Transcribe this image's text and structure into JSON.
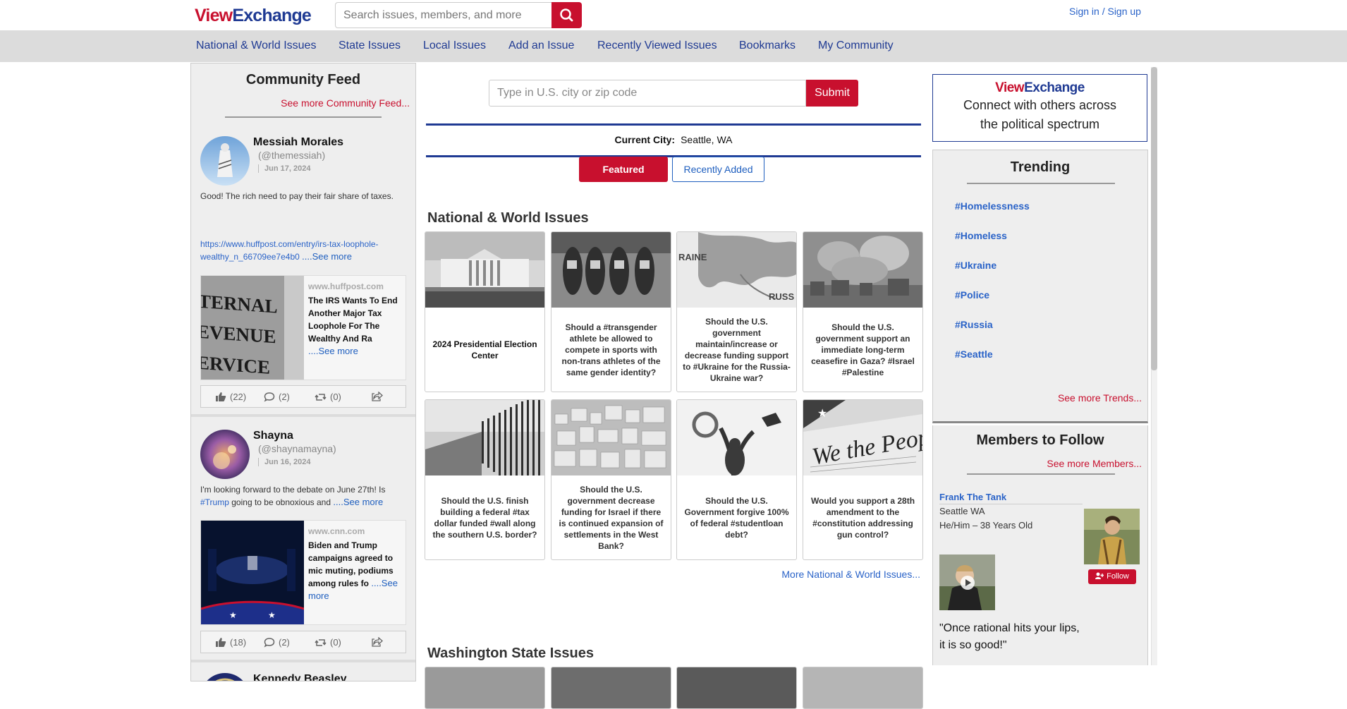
{
  "header": {
    "logo_view": "View",
    "logo_exchange": "Exchange",
    "search_placeholder": "Search issues, members, and more",
    "signin": "Sign in / Sign up"
  },
  "nav": [
    "National & World Issues",
    "State Issues",
    "Local Issues",
    "Add an Issue",
    "Recently Viewed Issues",
    "Bookmarks",
    "My Community"
  ],
  "feed": {
    "title": "Community Feed",
    "see_more": "See more Community Feed...",
    "posts": [
      {
        "name": "Messiah Morales",
        "handle": "(@themessiah)",
        "date": "Jun 17, 2024",
        "text": "Good! The rich need to pay their fair share of taxes.",
        "link": "https://www.huffpost.com/entry/irs-tax-loophole-wealthy_n_66709ee7e4b0",
        "text_more": "....See more",
        "card_domain": "www.huffpost.com",
        "card_title": "The IRS Wants To End Another Major Tax Loophole For The Wealthy And Ra",
        "card_more": "....See more",
        "likes": "(22)",
        "comments": "(2)",
        "shares": "(0)"
      },
      {
        "name": "Shayna",
        "handle": "(@shaynamayna)",
        "date": "Jun 16, 2024",
        "text_a": "I'm looking forward to the debate on June 27th! Is",
        "hashtag": "#Trump",
        "text_b": "going to be obnoxious and",
        "text_more": "....See more",
        "card_domain": "www.cnn.com",
        "card_title": "Biden and Trump campaigns agreed to mic muting, podiums among rules fo",
        "card_more": "....See more",
        "likes": "(18)",
        "comments": "(2)",
        "shares": "(0)"
      },
      {
        "name": "Kennedy Beasley"
      }
    ]
  },
  "center": {
    "zip_placeholder": "Type in U.S. city or zip code",
    "submit": "Submit",
    "current_city_label": "Current City:",
    "current_city": "Seattle, WA",
    "tab_featured": "Featured",
    "tab_recent": "Recently Added",
    "section_national": "National & World Issues",
    "issues": [
      "2024 Presidential Election Center",
      "Should a #transgender athlete be allowed to compete in sports with non-trans athletes of the same gender identity?",
      "Should the U.S. government maintain/increase or decrease funding support to #Ukraine for the Russia-Ukraine war?",
      "Should the U.S. government support an immediate long-term ceasefire in Gaza? #Israel #Palestine",
      "Should the U.S. finish building a federal #tax dollar funded #wall along the southern U.S. border?",
      "Should the U.S. government decrease funding for Israel if there is continued expansion of settlements in the West Bank?",
      "Should the U.S. Government forgive 100% of federal #studentloan debt?",
      "Would you support a 28th amendment to the #constitution addressing gun control?"
    ],
    "more_national": "More National & World Issues...",
    "section_state": "Washington State Issues"
  },
  "right": {
    "promo_view": "View",
    "promo_exchange": "Exchange",
    "promo_line1": "Connect with others across",
    "promo_line2": "the political spectrum",
    "trending_title": "Trending",
    "trends": [
      "#Homelessness",
      "#Homeless",
      "#Ukraine",
      "#Police",
      "#Russia",
      "#Seattle"
    ],
    "trending_more": "See more Trends...",
    "members_title": "Members to Follow",
    "members_more": "See more Members...",
    "member": {
      "name": "Frank The Tank",
      "location": "Seattle WA",
      "pronouns": "He/Him – 38 Years Old",
      "follow": "Follow",
      "quote_1": "\"Once rational hits your lips,",
      "quote_2": "it is so good!\""
    }
  },
  "colors": {
    "brand_red": "#c8102e",
    "brand_blue": "#1f3a93",
    "link_blue": "#2a63c8"
  }
}
